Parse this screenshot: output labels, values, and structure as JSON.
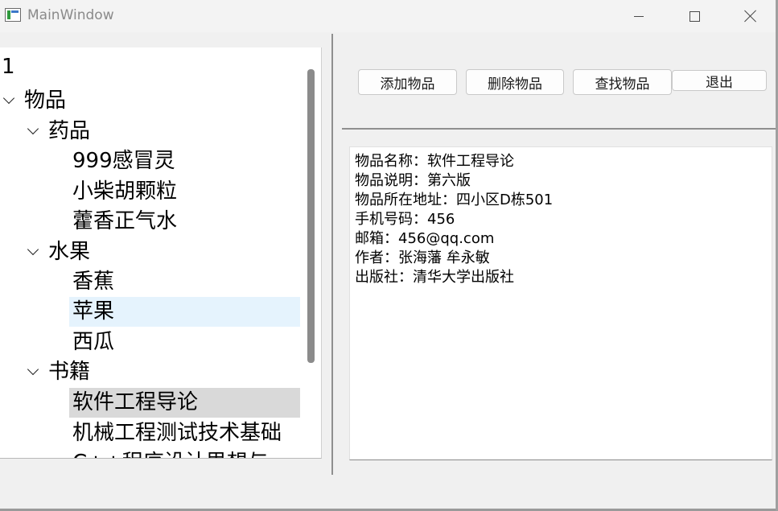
{
  "window": {
    "title": "MainWindow"
  },
  "tree": {
    "items": [
      {
        "label": "1"
      },
      {
        "label": "物品"
      },
      {
        "label": "药品"
      },
      {
        "label": "999感冒灵"
      },
      {
        "label": "小柴胡颗粒"
      },
      {
        "label": "藿香正气水"
      },
      {
        "label": "水果"
      },
      {
        "label": "香蕉"
      },
      {
        "label": "苹果"
      },
      {
        "label": "西瓜"
      },
      {
        "label": "书籍"
      },
      {
        "label": "软件工程导论"
      },
      {
        "label": "机械工程测试技术基础"
      },
      {
        "label": "C++程序设计思想与"
      }
    ]
  },
  "toolbar": {
    "add_label": "添加物品",
    "delete_label": "删除物品",
    "find_label": "查找物品",
    "exit_label": "退出"
  },
  "info": {
    "lines": [
      "物品名称：软件工程导论",
      "物品说明：第六版",
      "物品所在地址：四小区D栋501",
      "手机号码：456",
      "邮箱：456@qq.com",
      "作者：张海藩 牟永敏",
      "出版社：清华大学出版社"
    ]
  }
}
